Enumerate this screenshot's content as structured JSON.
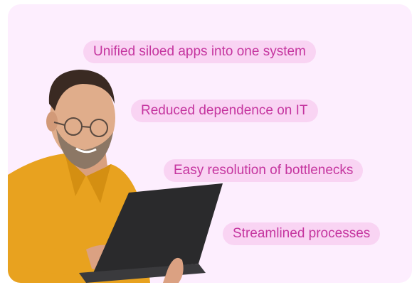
{
  "benefits": [
    {
      "label": "Unified siloed apps into one system"
    },
    {
      "label": "Reduced dependence on IT"
    },
    {
      "label": "Easy resolution of bottlenecks"
    },
    {
      "label": "Streamlined processes"
    }
  ],
  "colors": {
    "card_background": "#fdeefe",
    "pill_background": "#f9d4f3",
    "pill_text": "#c5359f"
  },
  "illustration": {
    "subject": "man-with-laptop",
    "shirt_color": "#e8a21f",
    "laptop_color": "#2a2a2c"
  }
}
